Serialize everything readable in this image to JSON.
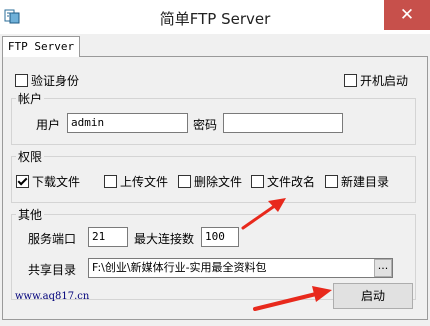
{
  "window": {
    "title": "简单FTP Server",
    "close_glyph": "✕"
  },
  "tab": {
    "label": "FTP Server"
  },
  "options": {
    "verify_identity": {
      "label": "验证身份",
      "checked": false
    },
    "autostart": {
      "label": "开机启动",
      "checked": false
    }
  },
  "account": {
    "group_title": "帐户",
    "user_label": "用户",
    "user_value": "admin",
    "password_label": "密码",
    "password_value": ""
  },
  "permissions": {
    "group_title": "权限",
    "items": [
      {
        "label": "下载文件",
        "checked": true
      },
      {
        "label": "上传文件",
        "checked": false
      },
      {
        "label": "删除文件",
        "checked": false
      },
      {
        "label": "文件改名",
        "checked": false
      },
      {
        "label": "新建目录",
        "checked": false
      }
    ]
  },
  "other": {
    "group_title": "其他",
    "port_label": "服务端口",
    "port_value": "21",
    "maxconn_label": "最大连接数",
    "maxconn_value": "100",
    "share_label": "共享目录",
    "share_value": "F:\\创业\\新媒体行业-实用最全资料包",
    "browse_label": "..."
  },
  "footer": {
    "website": "www.aq817.cn",
    "start_label": "启动"
  },
  "colors": {
    "close_bg": "#c7504b",
    "arrow": "#e8291c",
    "link": "#00007a"
  },
  "icons": [
    "app-icon",
    "close-icon",
    "checkbox-icon",
    "arrow-annotation-icon"
  ]
}
